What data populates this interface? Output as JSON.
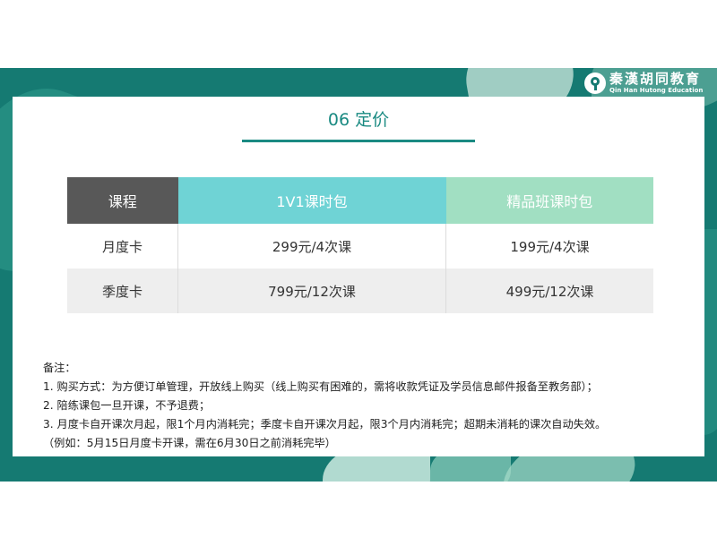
{
  "logo": {
    "cn": "秦漢胡同教育",
    "en": "Qin Han Hutong Education"
  },
  "title": "06 定价",
  "table": {
    "headers": [
      "课程",
      "1V1课时包",
      "精品班课时包"
    ],
    "rows": [
      [
        "月度卡",
        "299元/4次课",
        "199元/4次课"
      ],
      [
        "季度卡",
        "799元/12次课",
        "499元/12次课"
      ]
    ]
  },
  "notes": [
    "备注：",
    "1. 购买方式：为方便订单管理，开放线上购买（线上购买有困难的，需将收款凭证及学员信息邮件报备至教务部）；",
    "2. 陪练课包一旦开课，不予退费；",
    "3. 月度卡自开课次月起，限1个月内消耗完；季度卡自开课次月起，限3个月内消耗完；超期未消耗的课次自动失效。",
    "（例如：5月15日月度卡开课，需在6月30日之前消耗完毕）"
  ],
  "colors": {
    "band": "#157a72",
    "accent": "#1a8a82",
    "header_dark": "#585858",
    "header_1v1": "#6fd3d5",
    "header_class": "#a1dfc2"
  }
}
